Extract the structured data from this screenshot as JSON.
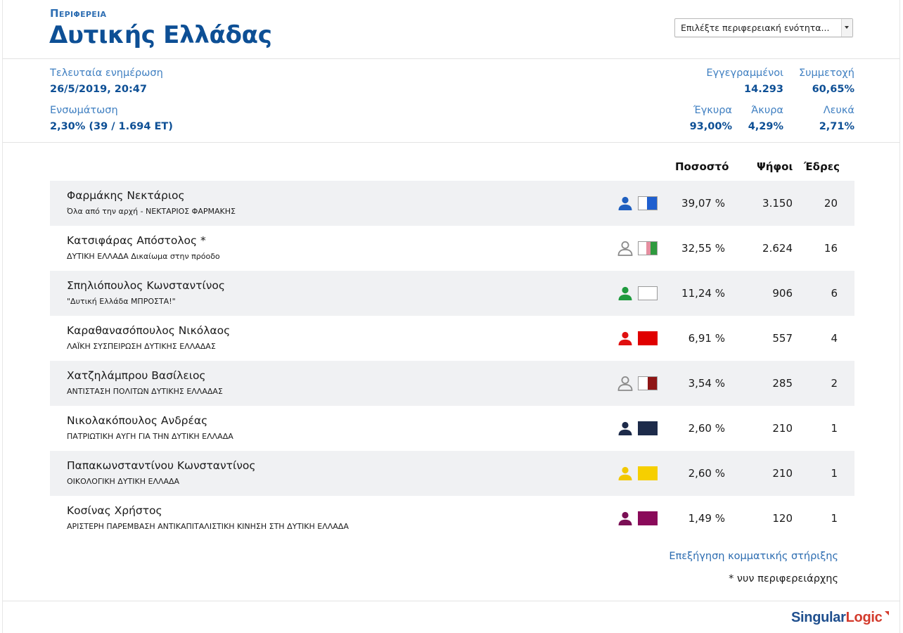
{
  "header": {
    "region_label": "Περιφερεια",
    "title": "Δυτικής Ελλάδας",
    "select_placeholder": "Επιλέξτε περιφερειακή ενότητα..."
  },
  "stats": {
    "last_update_label": "Τελευταία ενημέρωση",
    "last_update_value": "26/5/2019, 20:47",
    "integration_label": "Ενσωμάτωση",
    "integration_value": "2,30% (39 / 1.694 ΕΤ)",
    "registered_label": "Εγγεγραμμένοι",
    "registered_value": "14.293",
    "turnout_label": "Συμμετοχή",
    "turnout_value": "60,65%",
    "valid_label": "Έγκυρα",
    "valid_value": "93,00%",
    "invalid_label": "Άκυρα",
    "invalid_value": "4,29%",
    "blank_label": "Λευκά",
    "blank_value": "2,71%"
  },
  "table": {
    "col_percent": "Ποσοστό",
    "col_votes": "Ψήφοι",
    "col_seats": "Έδρες",
    "rows": [
      {
        "name": "Φαρμάκης Νεκτάριος",
        "party": "Όλα από την αρχή - ΝΕΚΤΑΡΙΟΣ ΦΑΡΜΑΚΗΣ",
        "percent": "39,07 %",
        "votes": "3.150",
        "seats": "20",
        "person_color": "#1f5fbf",
        "person_outline": false,
        "flag_color": "#1f5fcf",
        "flag_fill": 0.55
      },
      {
        "name": "Κατσιφάρας Απόστολος *",
        "party": "ΔΥΤΙΚΗ ΕΛΛΑΔΑ Δικαίωμα στην πρόοδο",
        "percent": "32,55 %",
        "votes": "2.624",
        "seats": "16",
        "person_color": "#8a8a8a",
        "person_outline": true,
        "flag_color": "#2e9a3e",
        "flag_fill": 0.35
      },
      {
        "name": "Σπηλιόπουλος Κωνσταντίνος",
        "party": "\"Δυτική Ελλάδα ΜΠΡΟΣΤΑ!\"",
        "percent": "11,24 %",
        "votes": "906",
        "seats": "6",
        "person_color": "#1f9a3e",
        "person_outline": false,
        "flag_color": "#ffffff",
        "flag_fill": 0.0
      },
      {
        "name": "Καραθανασόπουλος Νικόλαος",
        "party": "ΛΑΪΚΗ ΣΥΣΠΕΙΡΩΣΗ ΔΥΤΙΚΗΣ ΕΛΛΑΔΑΣ",
        "percent": "6,91 %",
        "votes": "557",
        "seats": "4",
        "person_color": "#e01010",
        "person_outline": false,
        "flag_color": "#e00000",
        "flag_fill": 1.0
      },
      {
        "name": "Χατζηλάμπρου Βασίλειος",
        "party": "ΑΝΤΙΣΤΑΣΗ ΠΟΛΙΤΩΝ ΔΥΤΙΚΗΣ ΕΛΛΑΔΑΣ",
        "percent": "3,54 %",
        "votes": "285",
        "seats": "2",
        "person_color": "#8a8a8a",
        "person_outline": true,
        "flag_color": "#8e1515",
        "flag_fill": 0.5
      },
      {
        "name": "Νικολακόπουλος Ανδρέας",
        "party": "ΠΑΤΡΙΩΤΙΚΗ ΑΥΓΗ ΓΙΑ ΤΗΝ ΔΥΤΙΚΗ ΕΛΛΑΔΑ",
        "percent": "2,60 %",
        "votes": "210",
        "seats": "1",
        "person_color": "#1d2b4a",
        "person_outline": false,
        "flag_color": "#1d2b4a",
        "flag_fill": 1.0
      },
      {
        "name": "Παπακωνσταντίνου Κωνσταντίνος",
        "party": "ΟΙΚΟΛΟΓΙΚΗ ΔΥΤΙΚΗ ΕΛΛΑΔΑ",
        "percent": "2,60 %",
        "votes": "210",
        "seats": "1",
        "person_color": "#f2c800",
        "person_outline": false,
        "flag_color": "#f6cf00",
        "flag_fill": 1.0
      },
      {
        "name": "Κοσίνας Χρήστος",
        "party": "ΑΡΙΣΤΕΡΗ ΠΑΡΕΜΒΑΣΗ ΑΝΤΙΚΑΠΙΤΑΛΙΣΤΙΚΗ ΚΙΝΗΣΗ ΣΤΗ ΔΥΤΙΚΗ ΕΛΛΑΔΑ",
        "percent": "1,49 %",
        "votes": "120",
        "seats": "1",
        "person_color": "#7a0f55",
        "person_outline": false,
        "flag_color": "#8a0a5a",
        "flag_fill": 1.0
      }
    ]
  },
  "footer": {
    "support_link": "Επεξήγηση κομματικής στήριξης",
    "note": "* νυν περιφερειάρχης",
    "logo_part1": "Singular",
    "logo_part2": "Logic"
  }
}
